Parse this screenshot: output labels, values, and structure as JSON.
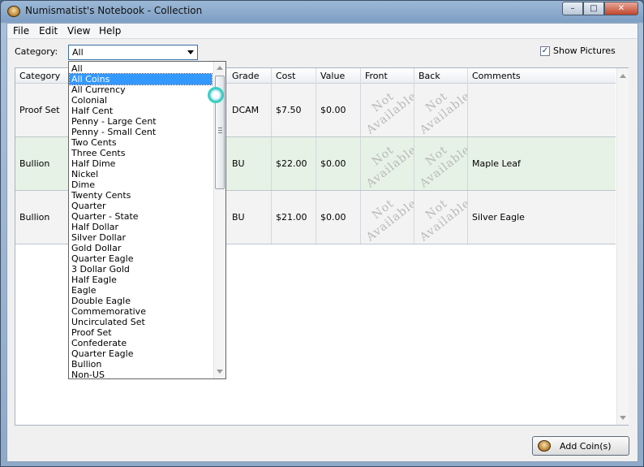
{
  "window": {
    "title": "Numismatist's Notebook - Collection",
    "controls": {
      "minimize": "–",
      "maximize": "□",
      "close": "✕"
    }
  },
  "menu": [
    "File",
    "Edit",
    "View",
    "Help"
  ],
  "filter": {
    "label": "Category:",
    "selected": "All"
  },
  "show_pictures": {
    "label": "Show Pictures",
    "checked": true,
    "check_glyph": "✓"
  },
  "columns": [
    "Category",
    "Grade",
    "Cost",
    "Value",
    "Front",
    "Back",
    "Comments"
  ],
  "rows": [
    {
      "category": "Proof Set",
      "grade": "DCAM",
      "cost": "$7.50",
      "value": "$0.00",
      "front": "Not Available",
      "back": "Not Available",
      "comments": ""
    },
    {
      "category": "Bullion",
      "grade": "BU",
      "cost": "$22.00",
      "value": "$0.00",
      "front": "Not Available",
      "back": "Not Available",
      "comments": "Maple Leaf"
    },
    {
      "category": "Bullion",
      "grade": "BU",
      "cost": "$21.00",
      "value": "$0.00",
      "front": "Not Available",
      "back": "Not Available",
      "comments": "Silver Eagle"
    }
  ],
  "dropdown": {
    "highlighted": "All Coins",
    "items": [
      "All",
      "All Coins",
      "All Currency",
      "Colonial",
      "Half Cent",
      "Penny - Large Cent",
      "Penny - Small Cent",
      "Two Cents",
      "Three Cents",
      "Half Dime",
      "Nickel",
      "Dime",
      "Twenty Cents",
      "Quarter",
      "Quarter - State",
      "Half Dollar",
      "Silver Dollar",
      "Gold Dollar",
      "Quarter Eagle",
      "3 Dollar Gold",
      "Half Eagle",
      "Eagle",
      "Double Eagle",
      "Commemorative",
      "Uncirculated Set",
      "Proof Set",
      "Confederate",
      "Quarter Eagle",
      "Bullion",
      "Non-US"
    ]
  },
  "add_button": {
    "label": "Add Coin(s)",
    "icon": "coin-icon"
  },
  "colors": {
    "selection": "#3399ff",
    "selected_row": "#e6f2e6"
  }
}
